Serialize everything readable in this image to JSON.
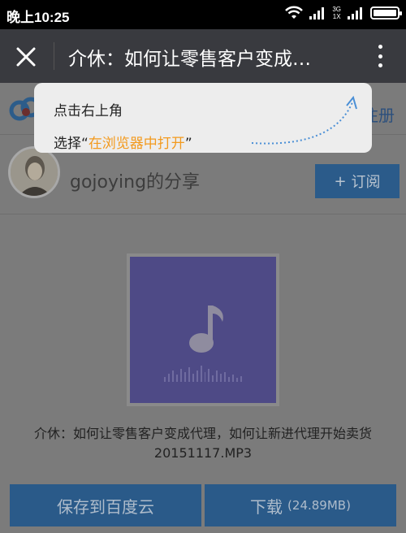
{
  "status_bar": {
    "time": "晚上10:25",
    "network_top": "3G",
    "network_bottom": "1X"
  },
  "title_bar": {
    "title": "介休：如何让零售客户变成…"
  },
  "app_header": {
    "register": "注册"
  },
  "user": {
    "name": "gojoying的分享",
    "subscribe_label": "订阅"
  },
  "track": {
    "title": "介休：如何让零售客户变成代理，如何让新进代理开始卖货20151117.MP3"
  },
  "buttons": {
    "save_label": "保存到百度云",
    "download_label": "下载",
    "download_size": "(24.89MB)"
  },
  "tooltip": {
    "line1": "点击右上角",
    "line2_prefix": "选择“",
    "line2_highlight": "在浏览器中打开",
    "line2_suffix": "”"
  },
  "colors": {
    "title_bar": "#393a3f",
    "highlight": "#f39a1e",
    "button": "#2a5a89",
    "cover": "#4e4a86"
  }
}
